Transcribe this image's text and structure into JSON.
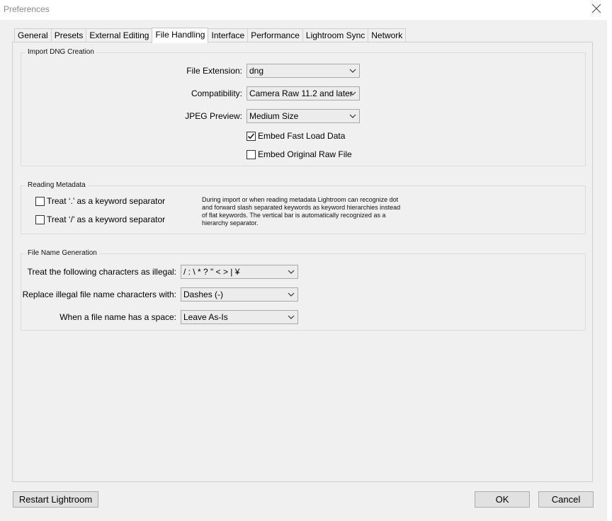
{
  "window": {
    "title": "Preferences",
    "close_icon": "close-icon"
  },
  "tabs": [
    {
      "label": "General"
    },
    {
      "label": "Presets"
    },
    {
      "label": "External Editing"
    },
    {
      "label": "File Handling"
    },
    {
      "label": "Interface"
    },
    {
      "label": "Performance"
    },
    {
      "label": "Lightroom Sync"
    },
    {
      "label": "Network"
    }
  ],
  "active_tab": "File Handling",
  "import_dng": {
    "title": "Import DNG Creation",
    "file_extension": {
      "label": "File Extension:",
      "value": "dng"
    },
    "compatibility": {
      "label": "Compatibility:",
      "value": "Camera Raw 11.2 and later"
    },
    "jpeg_preview": {
      "label": "JPEG Preview:",
      "value": "Medium Size"
    },
    "embed_fast_load": {
      "label": "Embed Fast Load Data",
      "checked": true
    },
    "embed_original_raw": {
      "label": "Embed Original Raw File",
      "checked": false
    }
  },
  "reading_metadata": {
    "title": "Reading Metadata",
    "dot_separator": {
      "label": "Treat ‘.’ as a keyword separator",
      "checked": false
    },
    "slash_separator": {
      "label": "Treat ‘/’ as a keyword separator",
      "checked": false
    },
    "info_lines": [
      "During import or when reading metadata Lightroom can recognize dot",
      "and forward slash separated keywords as keyword hierarchies instead",
      "of flat keywords. The vertical bar is automatically recognized as a",
      "hierarchy separator."
    ]
  },
  "file_name_generation": {
    "title": "File Name Generation",
    "illegal_chars": {
      "label": "Treat the following characters as illegal:",
      "value": "/ : \\ * ? \" < > | ¥"
    },
    "replace_with": {
      "label": "Replace illegal file name characters with:",
      "value": "Dashes (-)"
    },
    "space_handling": {
      "label": "When a file name has a space:",
      "value": "Leave As-Is"
    }
  },
  "buttons": {
    "restart": "Restart Lightroom",
    "ok": "OK",
    "cancel": "Cancel"
  },
  "colors": {
    "background": "#f0f0f0",
    "tab_active": "#ffffff",
    "border": "#d0d0d0"
  }
}
